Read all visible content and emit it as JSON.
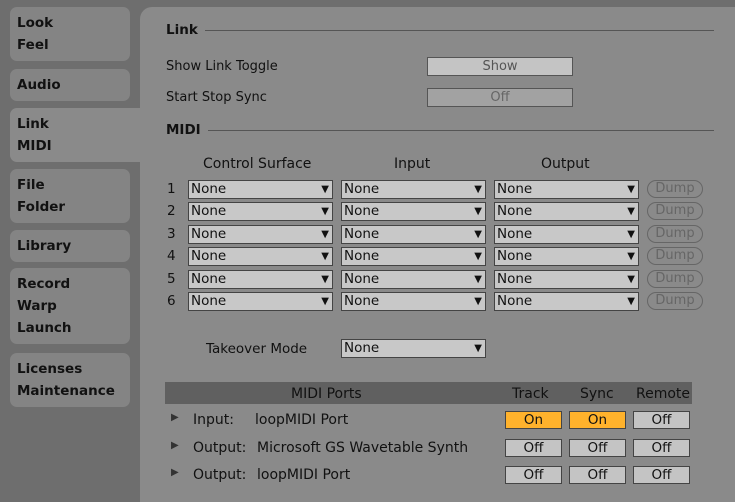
{
  "sidebar": {
    "tabs": [
      [
        "Look",
        "Feel"
      ],
      [
        "Audio"
      ],
      [
        "Link",
        "MIDI"
      ],
      [
        "File",
        "Folder"
      ],
      [
        "Library"
      ],
      [
        "Record",
        "Warp",
        "Launch"
      ],
      [
        "Licenses",
        "Maintenance"
      ]
    ],
    "selected": 2
  },
  "link": {
    "title": "Link",
    "show_toggle_label": "Show Link Toggle",
    "show_toggle_value": "Show",
    "start_stop_label": "Start Stop Sync",
    "start_stop_value": "Off"
  },
  "midi": {
    "title": "MIDI",
    "col_control": "Control Surface",
    "col_input": "Input",
    "col_output": "Output",
    "rows": [
      {
        "n": "1",
        "control": "None",
        "input": "None",
        "output": "None",
        "dump": "Dump"
      },
      {
        "n": "2",
        "control": "None",
        "input": "None",
        "output": "None",
        "dump": "Dump"
      },
      {
        "n": "3",
        "control": "None",
        "input": "None",
        "output": "None",
        "dump": "Dump"
      },
      {
        "n": "4",
        "control": "None",
        "input": "None",
        "output": "None",
        "dump": "Dump"
      },
      {
        "n": "5",
        "control": "None",
        "input": "None",
        "output": "None",
        "dump": "Dump"
      },
      {
        "n": "6",
        "control": "None",
        "input": "None",
        "output": "None",
        "dump": "Dump"
      }
    ],
    "takeover_label": "Takeover Mode",
    "takeover_value": "None"
  },
  "ports": {
    "header": "MIDI Ports",
    "col_track": "Track",
    "col_sync": "Sync",
    "col_remote": "Remote",
    "rows": [
      {
        "type": "Input:",
        "name": "loopMIDI Port",
        "track": "On",
        "sync": "On",
        "remote": "Off"
      },
      {
        "type": "Output:",
        "name": "Microsoft GS Wavetable Synth",
        "track": "Off",
        "sync": "Off",
        "remote": "Off"
      },
      {
        "type": "Output:",
        "name": "loopMIDI Port",
        "track": "Off",
        "sync": "Off",
        "remote": "Off"
      }
    ]
  },
  "colors": {
    "on": "#ffb22c",
    "panel": "#8a8a8a",
    "background": "#6e6e6e"
  }
}
